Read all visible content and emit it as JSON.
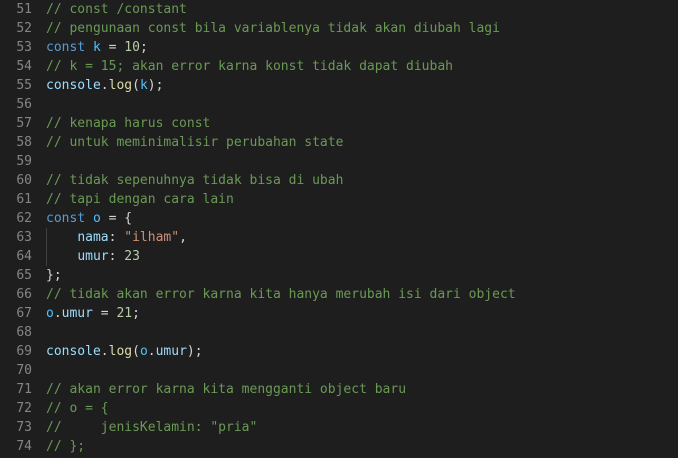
{
  "editor": {
    "lines": [
      {
        "num": "51",
        "tokens": [
          {
            "t": "comment",
            "v": "// const /constant"
          }
        ]
      },
      {
        "num": "52",
        "tokens": [
          {
            "t": "comment",
            "v": "// pengunaan const bila variablenya tidak akan diubah lagi"
          }
        ]
      },
      {
        "num": "53",
        "tokens": [
          {
            "t": "keyword",
            "v": "const"
          },
          {
            "t": "plain",
            "v": " "
          },
          {
            "t": "const-var",
            "v": "k"
          },
          {
            "t": "plain",
            "v": " = "
          },
          {
            "t": "number",
            "v": "10"
          },
          {
            "t": "plain",
            "v": ";"
          }
        ]
      },
      {
        "num": "54",
        "tokens": [
          {
            "t": "comment",
            "v": "// k = 15; akan error karna konst tidak dapat diubah"
          }
        ]
      },
      {
        "num": "55",
        "tokens": [
          {
            "t": "var",
            "v": "console"
          },
          {
            "t": "plain",
            "v": "."
          },
          {
            "t": "func",
            "v": "log"
          },
          {
            "t": "plain",
            "v": "("
          },
          {
            "t": "const-var",
            "v": "k"
          },
          {
            "t": "plain",
            "v": ");"
          }
        ]
      },
      {
        "num": "56",
        "tokens": []
      },
      {
        "num": "57",
        "tokens": [
          {
            "t": "comment",
            "v": "// kenapa harus const"
          }
        ]
      },
      {
        "num": "58",
        "tokens": [
          {
            "t": "comment",
            "v": "// untuk meminimalisir perubahan state"
          }
        ]
      },
      {
        "num": "59",
        "tokens": []
      },
      {
        "num": "60",
        "tokens": [
          {
            "t": "comment",
            "v": "// tidak sepenuhnya tidak bisa di ubah"
          }
        ]
      },
      {
        "num": "61",
        "tokens": [
          {
            "t": "comment",
            "v": "// tapi dengan cara lain"
          }
        ]
      },
      {
        "num": "62",
        "tokens": [
          {
            "t": "keyword",
            "v": "const"
          },
          {
            "t": "plain",
            "v": " "
          },
          {
            "t": "const-var",
            "v": "o"
          },
          {
            "t": "plain",
            "v": " = {"
          }
        ]
      },
      {
        "num": "63",
        "tokens": [
          {
            "t": "plain",
            "v": "    "
          },
          {
            "t": "var",
            "v": "nama"
          },
          {
            "t": "plain",
            "v": ": "
          },
          {
            "t": "string",
            "v": "\"ilham\""
          },
          {
            "t": "plain",
            "v": ","
          }
        ]
      },
      {
        "num": "64",
        "tokens": [
          {
            "t": "plain",
            "v": "    "
          },
          {
            "t": "var",
            "v": "umur"
          },
          {
            "t": "plain",
            "v": ": "
          },
          {
            "t": "number",
            "v": "23"
          }
        ]
      },
      {
        "num": "65",
        "tokens": [
          {
            "t": "plain",
            "v": "};"
          }
        ]
      },
      {
        "num": "66",
        "tokens": [
          {
            "t": "comment",
            "v": "// tidak akan error karna kita hanya merubah isi dari object"
          }
        ]
      },
      {
        "num": "67",
        "tokens": [
          {
            "t": "const-var",
            "v": "o"
          },
          {
            "t": "plain",
            "v": "."
          },
          {
            "t": "var",
            "v": "umur"
          },
          {
            "t": "plain",
            "v": " = "
          },
          {
            "t": "number",
            "v": "21"
          },
          {
            "t": "plain",
            "v": ";"
          }
        ]
      },
      {
        "num": "68",
        "tokens": []
      },
      {
        "num": "69",
        "tokens": [
          {
            "t": "var",
            "v": "console"
          },
          {
            "t": "plain",
            "v": "."
          },
          {
            "t": "func",
            "v": "log"
          },
          {
            "t": "plain",
            "v": "("
          },
          {
            "t": "const-var",
            "v": "o"
          },
          {
            "t": "plain",
            "v": "."
          },
          {
            "t": "var",
            "v": "umur"
          },
          {
            "t": "plain",
            "v": ");"
          }
        ]
      },
      {
        "num": "70",
        "tokens": []
      },
      {
        "num": "71",
        "tokens": [
          {
            "t": "comment",
            "v": "// akan error karna kita mengganti object baru"
          }
        ]
      },
      {
        "num": "72",
        "tokens": [
          {
            "t": "comment",
            "v": "// o = {"
          }
        ]
      },
      {
        "num": "73",
        "tokens": [
          {
            "t": "comment",
            "v": "//     jenisKelamin: \"pria\""
          }
        ]
      },
      {
        "num": "74",
        "tokens": [
          {
            "t": "comment",
            "v": "// };"
          }
        ]
      }
    ]
  },
  "colors": {
    "background": "#1e1e1e",
    "line_number": "#858585",
    "comment": "#6a9955",
    "keyword": "#569cd6",
    "variable": "#9cdcfe",
    "constant": "#4fc1ff",
    "number": "#b5cea8",
    "string": "#ce9178",
    "function": "#dcdcaa",
    "plain": "#d4d4d4"
  }
}
